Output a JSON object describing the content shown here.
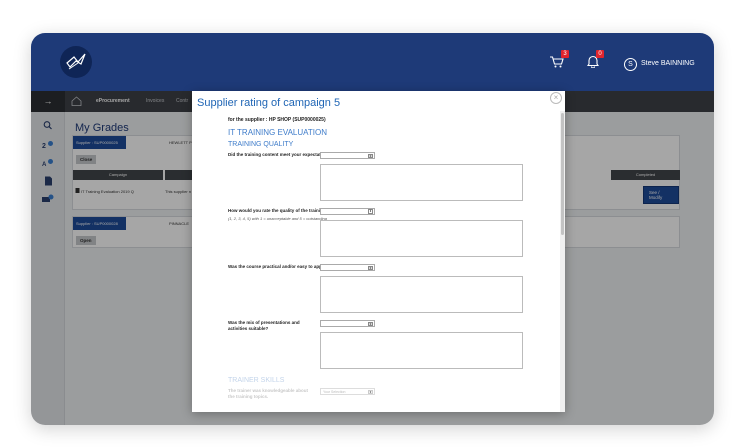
{
  "header": {
    "cart_count": "3",
    "notification_count": "0",
    "user_initial": "S",
    "user_name": "Steve BAINNING"
  },
  "navbar": {
    "items": [
      {
        "label": "eProcurement",
        "active": true
      },
      {
        "label": "Invoices",
        "active": false
      },
      {
        "label": "Contr",
        "active": false
      }
    ]
  },
  "page": {
    "title": "My Grades",
    "cards": [
      {
        "supplier_tab": "Supplier : SUP0000025",
        "supplier_name": "HEWLETT P",
        "button": "Close",
        "columns": [
          "Campaign",
          "Completed"
        ],
        "row": {
          "campaign": "IT Training Evaluation 2019 Q",
          "supplier": "This supplier n",
          "action": "See / Modify"
        }
      },
      {
        "supplier_tab": "Supplier : SUP0000028",
        "supplier_name": "PINNACLE",
        "button": "Open"
      }
    ]
  },
  "modal": {
    "title": "Supplier rating of campaign 5",
    "subtitle": "for the supplier : HP SHOP (SUP0000025)",
    "evaluation_title": "IT TRAINING EVALUATION",
    "sections": [
      {
        "title": "TRAINING QUALITY",
        "questions": [
          {
            "text": "Did the training content meet your expectations?"
          },
          {
            "text": "How would you rate the quality of the training?",
            "hint": "(1, 2, 3, 4, 5) with 1 = unacceptable and 5 = outstanding"
          },
          {
            "text": "Was the course practical and/or easy to apply?"
          },
          {
            "text": "Was the mix of presentations and activities suitable?"
          }
        ]
      },
      {
        "title": "TRAINER SKILLS",
        "questions": [
          {
            "text": "The trainer was knowledgeable about the training topics.",
            "select_value": "Your Selection"
          }
        ]
      }
    ]
  },
  "colors": {
    "brand_navy": "#1e3a78",
    "accent_blue": "#1f65b5",
    "badge_red": "#e0242d"
  }
}
